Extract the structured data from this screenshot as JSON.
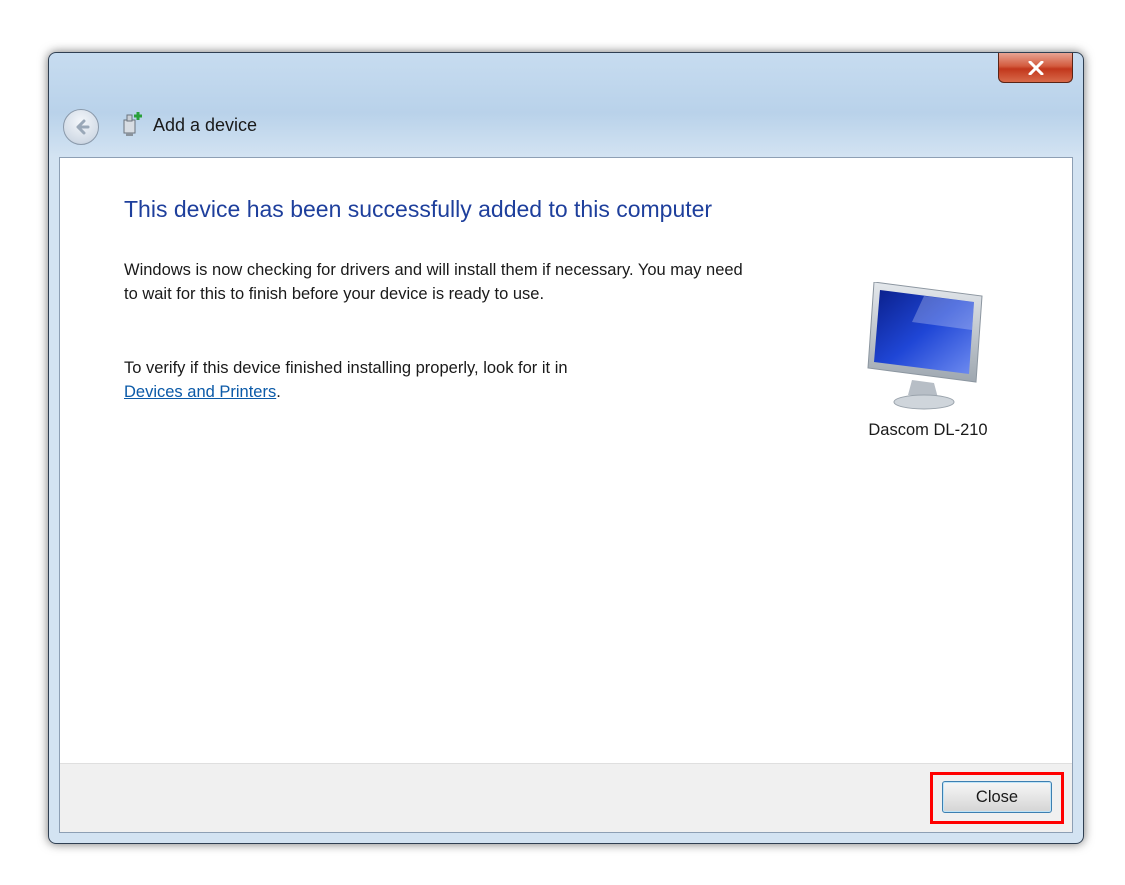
{
  "window": {
    "title": "Add a device"
  },
  "content": {
    "heading": "This device has been successfully added to this computer",
    "paragraph1": "Windows is now checking for drivers and will install them if necessary. You may need to wait for this to finish before your device is ready to use.",
    "paragraph2_text": "To verify if this device finished installing properly, look for it in",
    "paragraph2_link": "Devices and Printers",
    "paragraph2_end": ".",
    "device": {
      "name": "Dascom DL-210",
      "icon": "monitor-icon"
    }
  },
  "footer": {
    "close_label": "Close"
  },
  "icons": {
    "window_close": "close-icon",
    "back": "back-arrow-icon",
    "title": "add-device-icon"
  },
  "colors": {
    "heading": "#1e3f9c",
    "link": "#0b5aa8",
    "highlight": "#ff0000",
    "close_window": "#c2371c"
  }
}
